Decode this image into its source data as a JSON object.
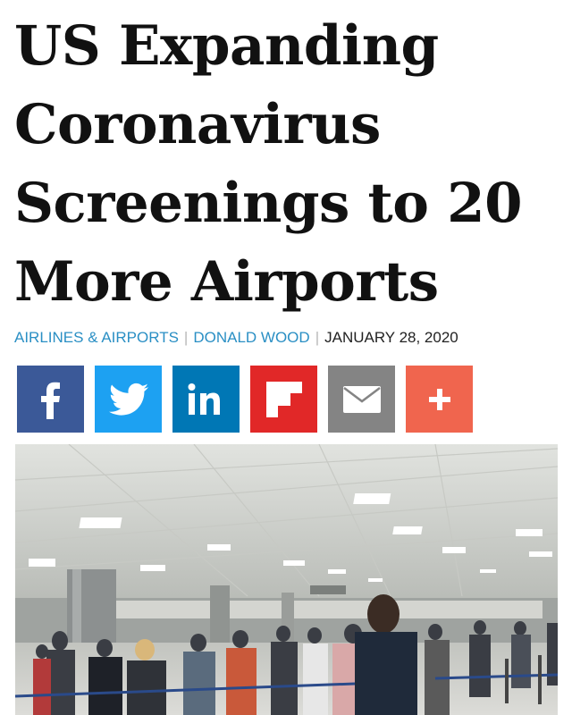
{
  "article": {
    "headline_lines": [
      "US Expanding",
      "Coronavirus",
      "Screenings to 20",
      "More Airports"
    ],
    "category": "AIRLINES & AIRPORTS",
    "author": "DONALD WOOD",
    "date": "JANUARY 28, 2020"
  },
  "share_buttons": [
    {
      "network": "facebook",
      "icon": "facebook-icon",
      "color": "#3b5998"
    },
    {
      "network": "twitter",
      "icon": "twitter-icon",
      "color": "#1da1f2"
    },
    {
      "network": "linkedin",
      "icon": "linkedin-icon",
      "color": "#0077b5"
    },
    {
      "network": "flipboard",
      "icon": "flipboard-icon",
      "color": "#e12828"
    },
    {
      "network": "email",
      "icon": "envelope-icon",
      "color": "#848484"
    },
    {
      "network": "more",
      "icon": "plus-icon",
      "color": "#f0654e"
    }
  ],
  "colors": {
    "link": "#2a8fc4",
    "separator": "#b8b8b8",
    "text": "#111111"
  }
}
